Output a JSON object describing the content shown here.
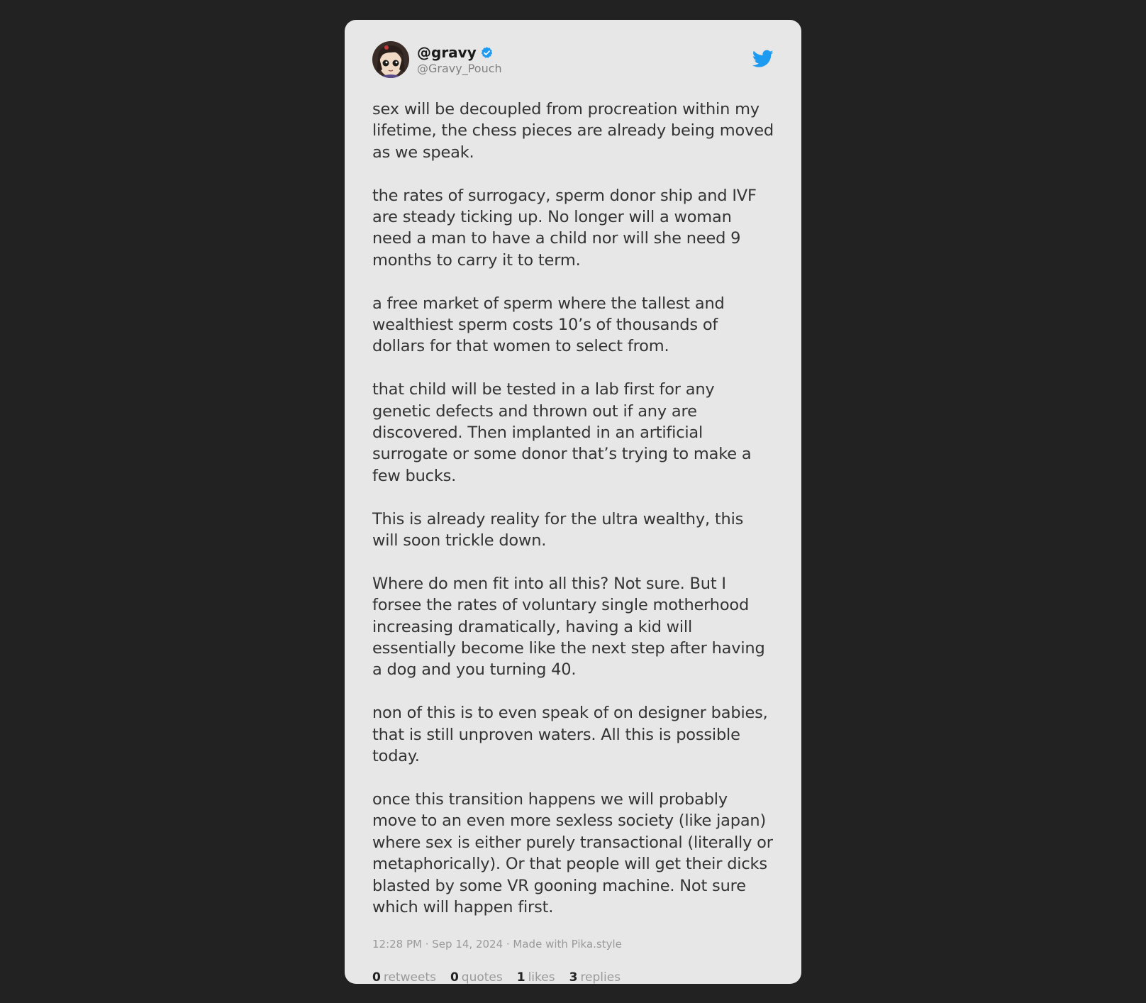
{
  "tweet": {
    "display_name": "@gravy",
    "handle": "@Gravy_Pouch",
    "verified": true,
    "paragraphs": [
      "sex will be decoupled from procreation within my lifetime, the chess pieces are already being moved as we speak.",
      "the rates of surrogacy, sperm donor ship and IVF are steady ticking up. No longer will a woman need a man to have a child nor will she need 9 months to carry it to term.",
      "a free market of sperm where the tallest and wealthiest sperm costs 10’s of thousands of dollars for that women to select from.",
      "that child will be tested in a lab first for any genetic defects and thrown out if any are discovered. Then implanted in an artificial surrogate or some donor that’s trying to make a few bucks.",
      "This is already reality for the ultra wealthy, this will soon trickle down.",
      "Where do men fit into all this? Not sure. But I forsee the rates of voluntary single motherhood increasing dramatically, having a kid will essentially become like the next step after having a dog and you turning 40.",
      "non of this is to even speak of on designer babies, that is still unproven waters. All this is possible today.",
      "once this transition happens we will probably move to an even more sexless society (like japan) where sex is either purely transactional (literally or metaphorically). Or that people will get their dicks blasted by some VR gooning machine. Not sure which will happen first."
    ],
    "meta": "12:28 PM · Sep 14, 2024 · Made with Pika.style",
    "stats": [
      {
        "count": "0",
        "label": "retweets"
      },
      {
        "count": "0",
        "label": "quotes"
      },
      {
        "count": "1",
        "label": "likes"
      },
      {
        "count": "3",
        "label": "replies"
      }
    ]
  },
  "icons": {
    "avatar": "avatar",
    "verified": "verified-badge-icon",
    "brand": "twitter-bird-icon"
  },
  "colors": {
    "background": "#222222",
    "card": "#e7e7e7",
    "accent": "#1d9bf0",
    "text": "#343434",
    "muted": "#9a9a9a"
  }
}
